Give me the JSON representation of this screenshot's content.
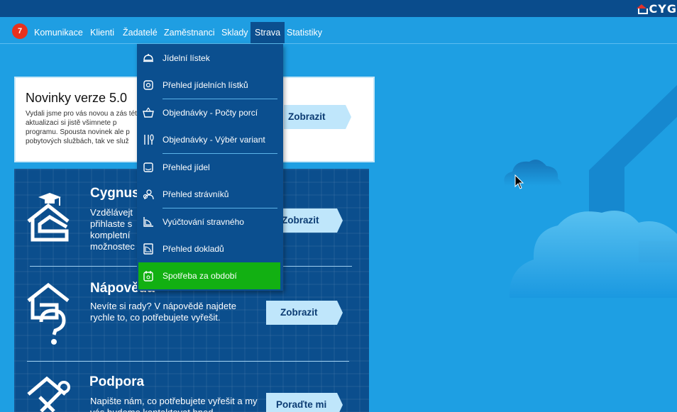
{
  "brand": {
    "logo_text": "CYG"
  },
  "nav": {
    "badge_count": "7",
    "items": [
      {
        "label": "Komunikace"
      },
      {
        "label": "Klienti"
      },
      {
        "label": "Žadatelé"
      },
      {
        "label": "Zaměstnanci"
      },
      {
        "label": "Sklady"
      },
      {
        "label": "Strava"
      },
      {
        "label": "Statistiky"
      }
    ],
    "active_item": "Strava"
  },
  "dropdown": {
    "items": [
      {
        "label": "Jídelní lístek",
        "icon": "cloche-icon"
      },
      {
        "label": "Přehled jídelních lístků",
        "icon": "menu-board-icon"
      },
      {
        "label": "Objednávky - Počty porcí",
        "icon": "basket-icon"
      },
      {
        "label": "Objednávky - Výběr variant",
        "icon": "cutlery-icon"
      },
      {
        "label": "Přehled jídel",
        "icon": "dish-icon"
      },
      {
        "label": "Přehled strávníků",
        "icon": "people-icon"
      },
      {
        "label": "Vyúčtování stravného",
        "icon": "chart-icon"
      },
      {
        "label": "Přehled dokladů",
        "icon": "document-icon"
      },
      {
        "label": "Spotřeba za období",
        "icon": "calendar-icon"
      }
    ],
    "selected_item": "Spotřeba za období"
  },
  "news": {
    "title": "Novinky verze 5.0",
    "text": "Vydali jsme pro vás novou a zás této aktualizaci si jistě všimnete p programu. Spousta novinek ale p pobytových službách, tak ve služ",
    "button": "Zobrazit"
  },
  "sections": [
    {
      "title": "Cygnus",
      "text": "Vzdělávejt přihlaste s kompletní možnostec",
      "button": "Zobrazit",
      "icon": "graduation-house-icon"
    },
    {
      "title": "Nápověda",
      "text": "Nevíte si rady? V nápovědě najdete rychle to, co potřebujete vyřešit.",
      "button": "Zobrazit",
      "icon": "question-house-icon"
    },
    {
      "title": "Podpora",
      "text": "Napište nám, co potřebujete vyřešit a my vás budeme kontaktovat hned",
      "button": "Poraďte mi",
      "icon": "tools-house-icon"
    }
  ],
  "colors": {
    "background": "#1e9fe3",
    "topbar": "#0a4c8c",
    "menu": "#0b4f8f",
    "selected": "#12b012",
    "badge": "#e8311e",
    "button": "#bfe6fb"
  }
}
